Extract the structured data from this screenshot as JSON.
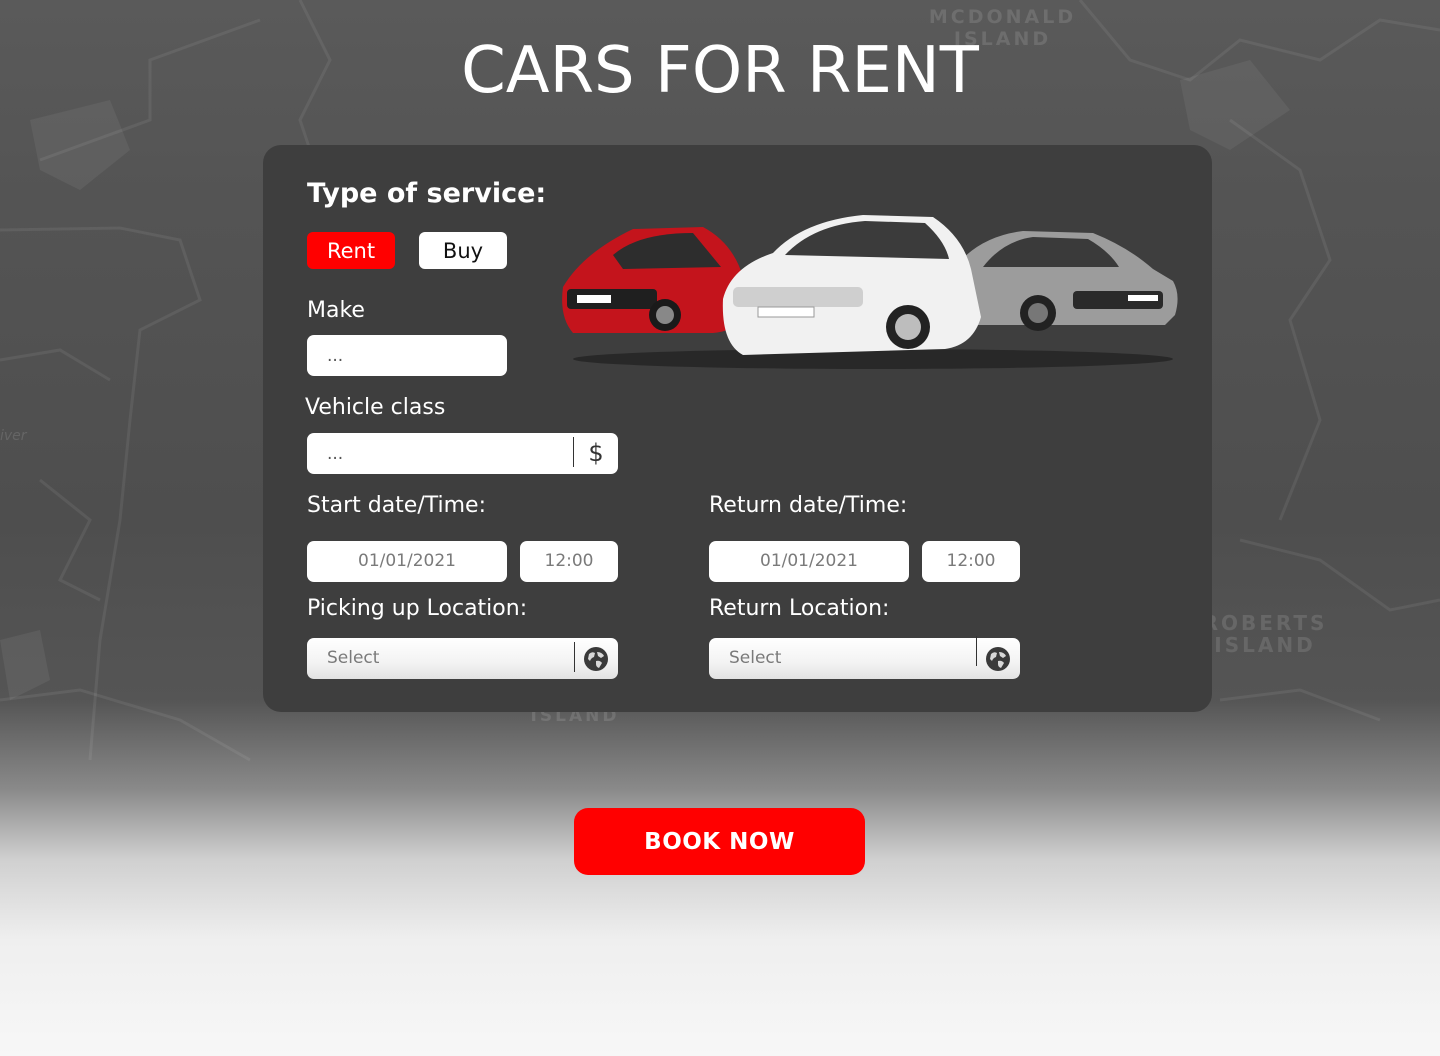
{
  "page": {
    "title": "CARS FOR RENT"
  },
  "map": {
    "labels": {
      "mcdonald_line1": "MCDONALD",
      "mcdonald_line2": "ISLAND",
      "roberts_line1": "ROBERTS",
      "roberts_line2": "ISLAND",
      "bottom": "ISLAND",
      "river": "iver"
    }
  },
  "form": {
    "heading": "Type of service:",
    "service_options": {
      "rent": "Rent",
      "buy": "Buy",
      "selected": "Rent"
    },
    "make": {
      "label": "Make",
      "value": "..."
    },
    "vehicle_class": {
      "label": "Vehicle class",
      "value": "...",
      "suffix": "$"
    },
    "start": {
      "label": "Start date/Time:",
      "date": "01/01/2021",
      "time": "12:00"
    },
    "return": {
      "label": "Return date/Time:",
      "date": "01/01/2021",
      "time": "12:00"
    },
    "pickup_location": {
      "label": "Picking up Location:",
      "placeholder": "Select",
      "icon": "globe-icon"
    },
    "return_location": {
      "label": "Return Location:",
      "placeholder": "Select",
      "icon": "globe-icon"
    }
  },
  "cta": {
    "book_now": "BOOK NOW"
  },
  "colors": {
    "accent": "#ff0000",
    "panel": "#3e3e3e",
    "title": "#ffffff"
  }
}
